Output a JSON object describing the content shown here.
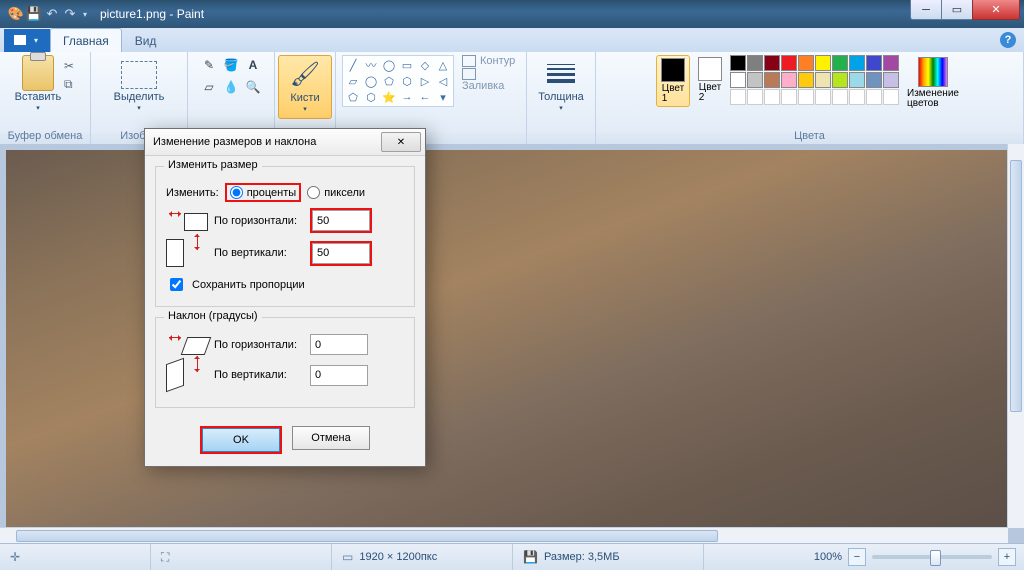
{
  "title": "picture1.png - Paint",
  "tabs": {
    "file": "",
    "main": "Главная",
    "view": "Вид"
  },
  "groups": {
    "clipboard": "Буфер обмена",
    "image": "Изобра",
    "tools": "",
    "brushes": "Кисти",
    "shapes": "",
    "thickness": "Толщина",
    "colors": "Цвета"
  },
  "buttons": {
    "paste": "Вставить",
    "select": "Выделить",
    "brushes": "Кисти",
    "outline": "Контур",
    "fill": "Заливка",
    "thickness": "Толщина",
    "color1": "Цвет\n1",
    "color2": "Цвет\n2",
    "editcolors": "Изменение\nцветов"
  },
  "palette_colors": [
    "#000000",
    "#7f7f7f",
    "#880015",
    "#ed1c24",
    "#ff7f27",
    "#fff200",
    "#22b14c",
    "#00a2e8",
    "#3f48cc",
    "#a349a4",
    "#ffffff",
    "#c3c3c3",
    "#b97a57",
    "#ffaec9",
    "#ffc90e",
    "#efe4b0",
    "#b5e61d",
    "#99d9ea",
    "#7092be",
    "#c8bfe7"
  ],
  "active_colors": {
    "c1": "#000000",
    "c2": "#ffffff"
  },
  "status": {
    "dims": "1920 × 1200пкс",
    "size": "Размер: 3,5МБ",
    "zoom": "100%"
  },
  "dialog": {
    "title": "Изменение размеров и наклона",
    "resize_legend": "Изменить размер",
    "by_label": "Изменить:",
    "percent": "проценты",
    "pixels": "пиксели",
    "horiz": "По горизонтали:",
    "vert": "По вертикали:",
    "h_val": "50",
    "v_val": "50",
    "keep": "Сохранить пропорции",
    "skew_legend": "Наклон (градусы)",
    "sh_val": "0",
    "sv_val": "0",
    "ok": "OK",
    "cancel": "Отмена"
  }
}
